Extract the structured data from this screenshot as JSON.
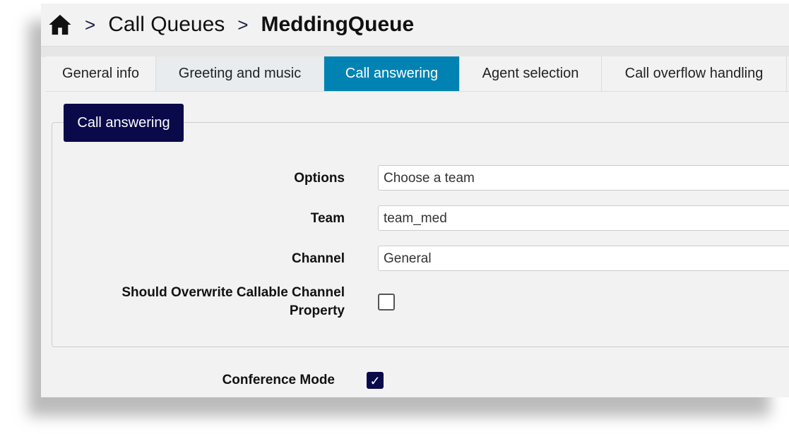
{
  "breadcrumb": {
    "home_icon": "home-icon",
    "items": [
      "Call Queues",
      "MeddingQueue"
    ]
  },
  "tabs": [
    {
      "label": "General info"
    },
    {
      "label": "Greeting and music"
    },
    {
      "label": "Call answering",
      "active": true
    },
    {
      "label": "Agent selection"
    },
    {
      "label": "Call overflow handling"
    }
  ],
  "section": {
    "title": "Call answering",
    "options": {
      "label": "Options",
      "value": "Choose a team"
    },
    "team": {
      "label": "Team",
      "value": "team_med"
    },
    "channel": {
      "label": "Channel",
      "value": "General"
    },
    "overwrite": {
      "label": "Should Overwrite Callable Channel Property",
      "checked": false
    }
  },
  "conference": {
    "label": "Conference Mode",
    "checked": true,
    "check_glyph": "✓"
  },
  "colors": {
    "active_tab": "#0083b3",
    "navy": "#0a0a4a"
  }
}
